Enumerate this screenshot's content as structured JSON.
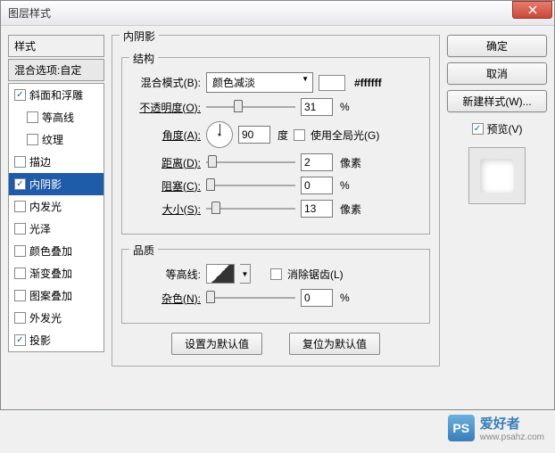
{
  "window": {
    "title": "图层样式"
  },
  "left": {
    "styles_header": "样式",
    "blend_options": "混合选项:自定",
    "items": [
      {
        "label": "斜面和浮雕",
        "checked": true
      },
      {
        "label": "等高线",
        "checked": false
      },
      {
        "label": "纹理",
        "checked": false
      },
      {
        "label": "描边",
        "checked": false
      },
      {
        "label": "内阴影",
        "checked": true,
        "selected": true
      },
      {
        "label": "内发光",
        "checked": false
      },
      {
        "label": "光泽",
        "checked": false
      },
      {
        "label": "颜色叠加",
        "checked": false
      },
      {
        "label": "渐变叠加",
        "checked": false
      },
      {
        "label": "图案叠加",
        "checked": false
      },
      {
        "label": "外发光",
        "checked": false
      },
      {
        "label": "投影",
        "checked": true
      }
    ]
  },
  "main": {
    "title": "内阴影",
    "structure_title": "结构",
    "blend_mode_label": "混合模式(B):",
    "blend_mode_value": "颜色减淡",
    "hex": "#ffffff",
    "opacity_label": "不透明度(O):",
    "opacity_value": "31",
    "percent": "%",
    "angle_label": "角度(A):",
    "angle_value": "90",
    "degree": "度",
    "global_light": "使用全局光(G)",
    "distance_label": "距离(D):",
    "distance_value": "2",
    "px": "像素",
    "choke_label": "阻塞(C):",
    "choke_value": "0",
    "size_label": "大小(S):",
    "size_value": "13",
    "quality_title": "品质",
    "contour_label": "等高线:",
    "antialias": "消除锯齿(L)",
    "noise_label": "杂色(N):",
    "noise_value": "0",
    "default_btn": "设置为默认值",
    "reset_btn": "复位为默认值"
  },
  "right": {
    "ok": "确定",
    "cancel": "取消",
    "new_style": "新建样式(W)...",
    "preview": "预览(V)"
  },
  "watermark": {
    "icon": "PS",
    "text": "爱好者",
    "url": "www.psahz.com"
  }
}
